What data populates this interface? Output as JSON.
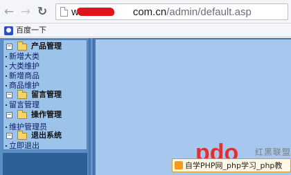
{
  "browser": {
    "url_prefix": "www.",
    "url_host": "com.cn",
    "url_path": "/admin/default.asp",
    "bookmark_label": "百度一下",
    "icons": {
      "back": "arrow-left-icon",
      "forward": "arrow-right-icon",
      "reload": "reload-icon",
      "page": "page-icon",
      "bookmark": "baidu-paw-icon"
    }
  },
  "sidebar": {
    "groups": [
      {
        "title": "产品管理",
        "items": [
          "新增大类",
          "大类维护",
          "新增商品",
          "商品维护"
        ]
      },
      {
        "title": "留言管理",
        "items": [
          "留言管理"
        ]
      },
      {
        "title": "操作管理",
        "items": [
          "维护管理员"
        ]
      },
      {
        "title": "退出系统",
        "items": [
          "立即退出"
        ]
      }
    ]
  },
  "watermark": {
    "logo_text": "pdo",
    "site_name_cn": "红黑联盟",
    "banner_text": "自学PHP网_php学习_php教"
  },
  "colors": {
    "sidebar_bg": "#9cc3ea",
    "main_bg": "#a7c8ee",
    "frame_blue": "#4f80bc",
    "redaction": "#e0141a",
    "watermark_red": "#e8201e"
  }
}
